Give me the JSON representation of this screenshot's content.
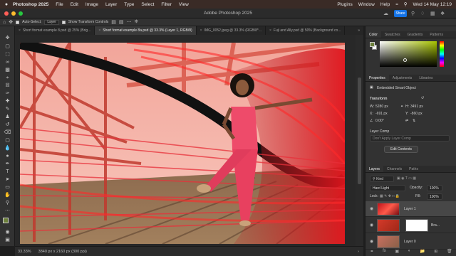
{
  "menubar": {
    "apple": "",
    "app_name": "Photoshop 2025",
    "items": [
      "File",
      "Edit",
      "Image",
      "Layer",
      "Type",
      "Select",
      "Filter",
      "View"
    ],
    "right_items": [
      "Plugins",
      "Window",
      "Help"
    ],
    "clock": "Wed 14 May 12:19"
  },
  "window": {
    "title": "Adobe Photoshop 2025",
    "share_label": "Share"
  },
  "options_bar": {
    "auto_select_label": "Auto-Select:",
    "auto_select_value": "Layer",
    "transform_controls_label": "Show Transform Controls"
  },
  "doc_tabs": [
    {
      "label": "Short format example 8.psd @ 25% (Brig...",
      "active": false
    },
    {
      "label": "Short format example 8a.psd @ 33.3% (Layer 1, RGB/8)",
      "active": true
    },
    {
      "label": "IMG_0052.jpeg @ 33.3% (RGB/8*...",
      "active": false
    },
    {
      "label": "Fuji and Ally.psd @ 50% (Background co...",
      "active": false
    }
  ],
  "status": {
    "zoom": "33.33%",
    "dims": "3840 px x 2160 px (300 ppi)"
  },
  "color_panel": {
    "tabs": [
      "Color",
      "Swatches",
      "Gradients",
      "Patterns"
    ],
    "foreground": "#6b7f3a",
    "background": "#ffffff"
  },
  "properties_panel": {
    "tabs": [
      "Properties",
      "Adjustments",
      "Libraries"
    ],
    "object_type": "Embedded Smart Object",
    "transform_label": "Transform",
    "w_label": "W:",
    "w_value": "5280 px",
    "h_label": "H:",
    "h_value": "3491 px",
    "x_label": "X:",
    "x_value": "-691 px",
    "y_label": "Y:",
    "y_value": "-860 px",
    "angle_value": "0.00°",
    "layer_comp_label": "Layer Comp",
    "layer_comp_placeholder": "Don't Apply Layer Comp",
    "edit_contents": "Edit Contents"
  },
  "layers_panel": {
    "tabs": [
      "Layers",
      "Channels",
      "Paths"
    ],
    "filter": "Kind",
    "blend_mode": "Hard Light",
    "opacity_label": "Opacity:",
    "opacity_value": "100%",
    "lock_label": "Lock:",
    "fill_label": "Fill:",
    "fill_value": "100%",
    "layers": [
      {
        "name": "Layer 1",
        "selected": true
      },
      {
        "name": "Bra...",
        "selected": false
      },
      {
        "name": "Layer 0",
        "selected": false
      }
    ]
  },
  "colors": {
    "accent": "#1473e6",
    "menubar_bg": "#3a2b26"
  }
}
